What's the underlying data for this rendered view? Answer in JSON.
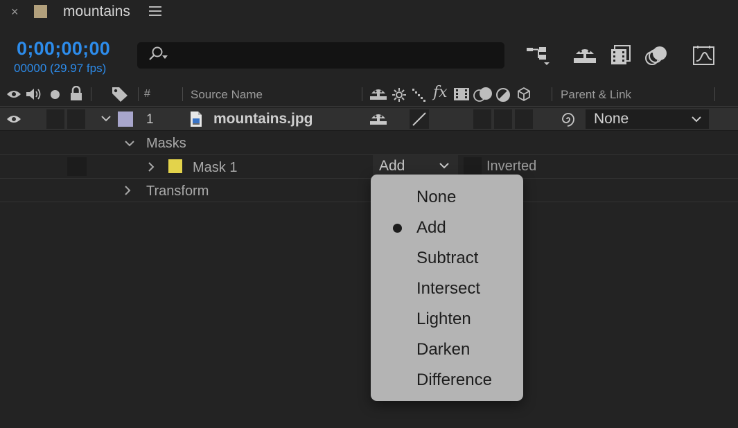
{
  "tab": {
    "close_glyph": "×",
    "title": "mountains",
    "swatch_color": "#b2a07c"
  },
  "timecode": {
    "current": "0;00;00;00",
    "frames": "00000 (29.97 fps)",
    "color": "#2d8ceb"
  },
  "search": {
    "placeholder": "",
    "value": ""
  },
  "toolbar": {
    "icons": [
      "composition-flowchart-icon",
      "draft-3d-icon",
      "frame-blending-icon",
      "motion-blur-icon",
      "graph-editor-icon"
    ]
  },
  "header": {
    "number": "#",
    "source_name": "Source Name",
    "parent_link": "Parent & Link",
    "fx": "fx"
  },
  "layer": {
    "number": "1",
    "name": "mountains.jpg",
    "label_color": "#a8a6cc",
    "parent": "None"
  },
  "masks": {
    "label": "Masks",
    "items": [
      {
        "name": "Mask 1",
        "color": "#e3d34b",
        "mode": "Add",
        "inverted_label": "Inverted"
      }
    ]
  },
  "transform": {
    "label": "Transform"
  },
  "mode_menu": {
    "selected": "Add",
    "options": [
      "None",
      "Add",
      "Subtract",
      "Intersect",
      "Lighten",
      "Darken",
      "Difference"
    ]
  }
}
